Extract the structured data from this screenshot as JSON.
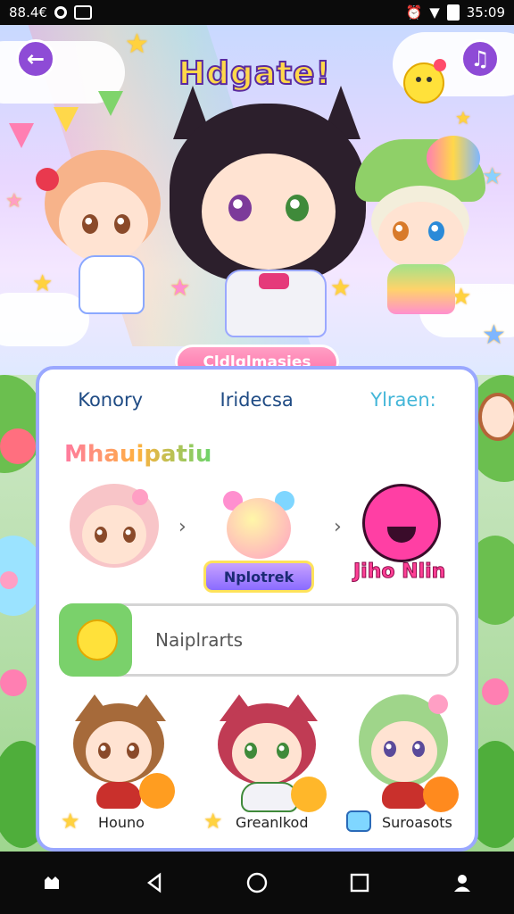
{
  "status_bar": {
    "time_left": "88.4€",
    "time_right": "35:09"
  },
  "header": {
    "title": "Hdgate!",
    "back_icon": "back-arrow-icon",
    "menu_icon": "music-note-icon",
    "emoji_icon": "emoji-face-icon"
  },
  "hero": {
    "cta_label": "Cldlglmasies"
  },
  "tabs": [
    {
      "label": "Konory"
    },
    {
      "label": "Iridecsa"
    },
    {
      "label": "Ylraen:"
    }
  ],
  "section_title": "Mhauipatiu",
  "feature_row": {
    "pill_label": "Nplotrek",
    "pink_label": "Jiho Nlin"
  },
  "search": {
    "placeholder": "Naiplrarts"
  },
  "characters": [
    {
      "label": "Houno",
      "icon": "star-icon"
    },
    {
      "label": "Greanlkod",
      "icon": "star-icon"
    },
    {
      "label": "Suroasots",
      "icon": "sticker-icon"
    }
  ],
  "colors": {
    "accent": "#8e4bd6",
    "pink": "#ff6fa8",
    "title": "#ffd84a"
  }
}
